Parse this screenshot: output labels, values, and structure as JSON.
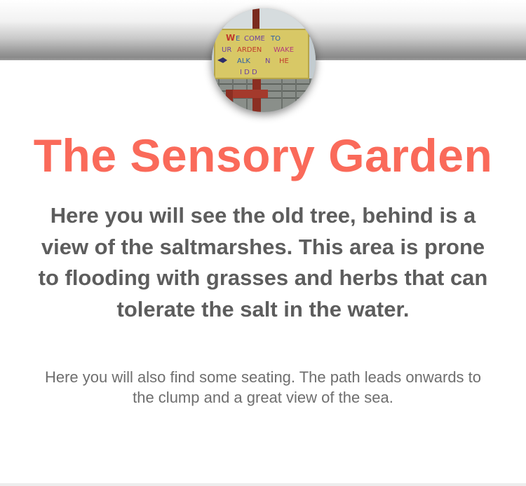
{
  "header": {
    "image_alt": "Welcome to our garden wake walk on the wild side sign",
    "sign_lines": [
      "WELCOME TO",
      "OUR GARDEN WAKE",
      "WALK ON THE",
      "WILD SIDE"
    ]
  },
  "main": {
    "title": "The Sensory Garden",
    "lead": "Here you will see the old tree, behind is a view of the saltmarshes. This area is prone to flooding with grasses and herbs that can tolerate the salt in the water.",
    "description": "Here you will also find some seating. The path leads onwards to the clump and a great view of the sea."
  },
  "colors": {
    "title": "#fa6a5a",
    "lead_text": "#5d5d5d",
    "body_text": "#6e6e6e"
  }
}
